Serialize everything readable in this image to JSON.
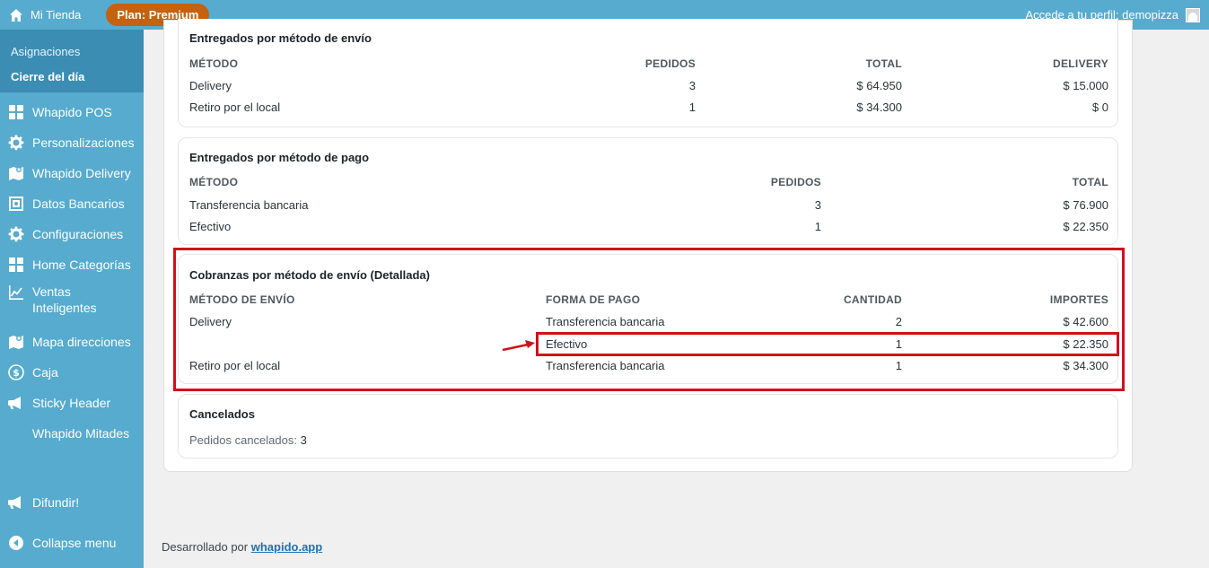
{
  "topbar": {
    "site_name": "Mi Tienda",
    "plan": "Plan: Premium",
    "account": "Accede a tu perfil: demopizza"
  },
  "sidebar": {
    "submenu": [
      {
        "label": "Asignaciones",
        "current": false
      },
      {
        "label": "Cierre del día",
        "current": true
      }
    ],
    "items": [
      {
        "label": "Whapido POS",
        "icon": "grid-icon"
      },
      {
        "label": "Personalizaciones",
        "icon": "gear-icon"
      },
      {
        "label": "Whapido Delivery",
        "icon": "map-icon"
      },
      {
        "label": "Datos Bancarios",
        "icon": "bank-icon"
      },
      {
        "label": "Configuraciones",
        "icon": "gear-icon"
      },
      {
        "label": "Home Categorías",
        "icon": "grid-icon"
      },
      {
        "label": "Ventas Inteligentes",
        "icon": "chart-line-icon"
      },
      {
        "label": "Mapa direcciones",
        "icon": "map-icon"
      },
      {
        "label": "Caja",
        "icon": "dollar-icon"
      },
      {
        "label": "Sticky Header",
        "icon": "megaphone-icon"
      },
      {
        "label": "Whapido Mitades",
        "icon": ""
      },
      {
        "label": "Difundir!",
        "icon": "megaphone-icon"
      },
      {
        "label": "Collapse menu",
        "icon": "collapse-icon"
      }
    ]
  },
  "shipping": {
    "title": "Entregados por método de envío",
    "headers": [
      "MÉTODO",
      "PEDIDOS",
      "TOTAL",
      "DELIVERY"
    ],
    "rows": [
      [
        "Delivery",
        "3",
        "$ 64.950",
        "$ 15.000"
      ],
      [
        "Retiro por el local",
        "1",
        "$ 34.300",
        "$ 0"
      ]
    ]
  },
  "payment": {
    "title": "Entregados por método de pago",
    "headers": [
      "MÉTODO",
      "PEDIDOS",
      "TOTAL"
    ],
    "rows": [
      [
        "Transferencia bancaria",
        "3",
        "$ 76.900"
      ],
      [
        "Efectivo",
        "1",
        "$ 22.350"
      ]
    ]
  },
  "collections": {
    "title": "Cobranzas por método de envío (Detallada)",
    "headers": [
      "MÉTODO DE ENVÍO",
      "FORMA DE PAGO",
      "CANTIDAD",
      "IMPORTES"
    ],
    "rows": [
      [
        "Delivery",
        "Transferencia bancaria",
        "2",
        "$ 42.600"
      ],
      [
        "",
        "Efectivo",
        "1",
        "$ 22.350"
      ],
      [
        "Retiro por el local",
        "Transferencia bancaria",
        "1",
        "$ 34.300"
      ]
    ]
  },
  "cancelled": {
    "title": "Cancelados",
    "label": "Pedidos cancelados:",
    "count": "3"
  },
  "footer": {
    "text": "Desarrollado por",
    "link": "whapido.app"
  },
  "colors": {
    "brand": "#56abcf",
    "badge": "#c4620f",
    "annotation": "#d0111b"
  }
}
